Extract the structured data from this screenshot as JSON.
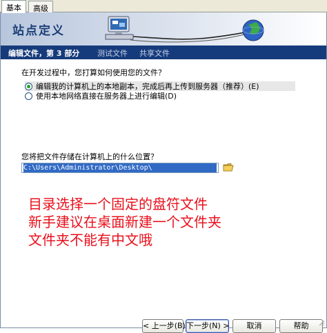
{
  "tabs": [
    {
      "label": "基本"
    },
    {
      "label": "高级"
    }
  ],
  "banner": {
    "title": "站点定义"
  },
  "steps": {
    "current": "编辑文件，第 3 部分",
    "next": "测试文件",
    "last": "共享文件"
  },
  "question1": "在开发过程中，您打算如何使用您的文件？",
  "options": [
    {
      "label": "编辑我的计算机上的本地副本，完成后再上传到服务器（推荐）(E)",
      "selected": true
    },
    {
      "label": "使用本地网络直接在服务器上进行编辑(D)",
      "selected": false
    }
  ],
  "question2": "您将把文件存储在计算机上的什么位置？",
  "path_field": {
    "value": "C:\\Users\\Administrator\\Desktop\\"
  },
  "annotation": [
    "目录选择一个固定的盘符文件",
    "新手建议在桌面新建一个文件夹",
    "文件夹不能有中文哦"
  ],
  "buttons": {
    "back": "< 上一步(B)",
    "next": "下一步(N) >",
    "cancel": "取消",
    "help": "帮助"
  },
  "colors": {
    "step_bar": "#163b7c",
    "annotation": "#e8101c",
    "radio_dot": "#21a121"
  }
}
